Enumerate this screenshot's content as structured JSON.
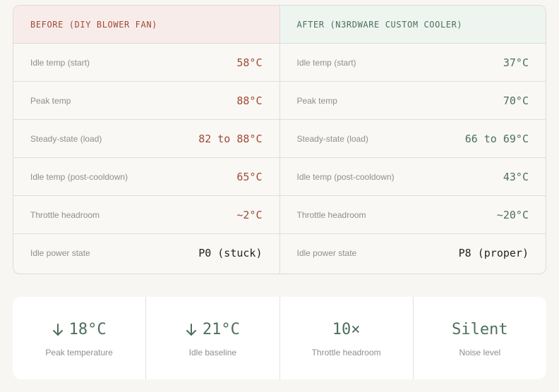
{
  "comparison": {
    "before": {
      "title": "BEFORE (DIY BLOWER FAN)",
      "rows": [
        {
          "label": "Idle temp (start)",
          "value": "58°C"
        },
        {
          "label": "Peak temp",
          "value": "88°C"
        },
        {
          "label": "Steady-state (load)",
          "value": "82 to 88°C"
        },
        {
          "label": "Idle temp (post-cooldown)",
          "value": "65°C"
        },
        {
          "label": "Throttle headroom",
          "value": "~2°C"
        },
        {
          "label": "Idle power state",
          "value": "P0 (stuck)"
        }
      ]
    },
    "after": {
      "title": "AFTER (N3RDWARE CUSTOM COOLER)",
      "rows": [
        {
          "label": "Idle temp (start)",
          "value": "37°C"
        },
        {
          "label": "Peak temp",
          "value": "70°C"
        },
        {
          "label": "Steady-state (load)",
          "value": "66 to 69°C"
        },
        {
          "label": "Idle temp (post-cooldown)",
          "value": "43°C"
        },
        {
          "label": "Throttle headroom",
          "value": "~20°C"
        },
        {
          "label": "Idle power state",
          "value": "P8 (proper)"
        }
      ]
    }
  },
  "stats": [
    {
      "icon": "arrow-down-icon",
      "value": "18°C",
      "label": "Peak temperature"
    },
    {
      "icon": "arrow-down-icon",
      "value": "21°C",
      "label": "Idle baseline"
    },
    {
      "icon": "",
      "value": "10×",
      "label": "Throttle headroom"
    },
    {
      "icon": "",
      "value": "Silent",
      "label": "Noise level"
    }
  ],
  "colors": {
    "before_accent": "#a04a36",
    "after_accent": "#4d6f5c",
    "before_header_bg": "#f8ecea",
    "after_header_bg": "#eef5f0"
  }
}
